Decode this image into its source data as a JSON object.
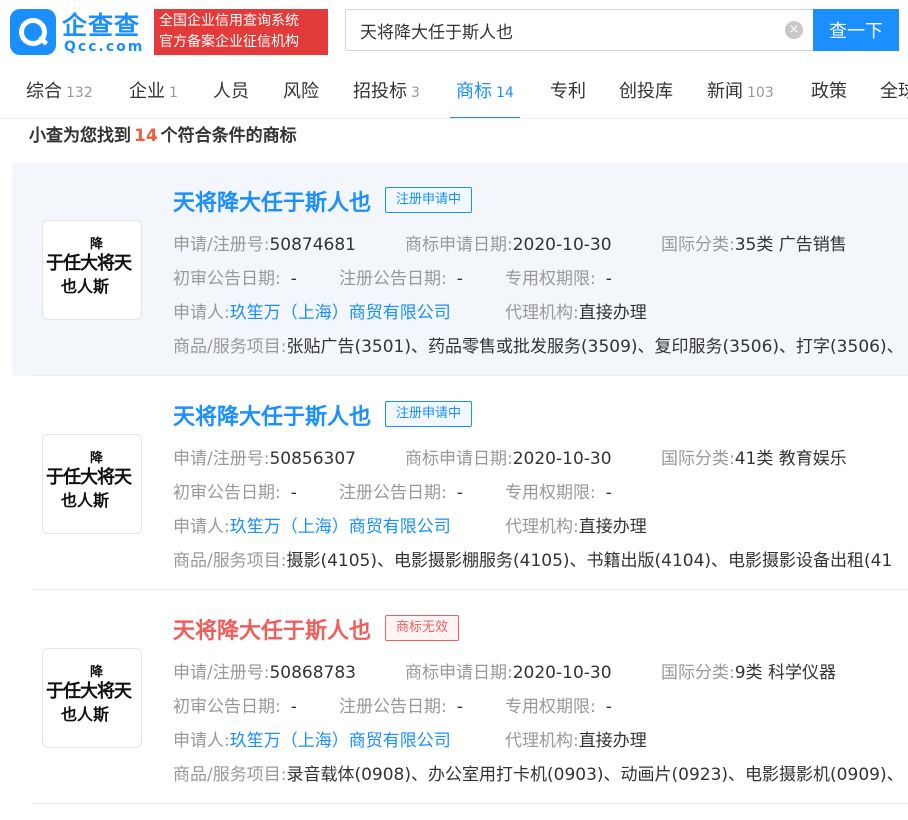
{
  "header": {
    "logo_cn": "企查查",
    "logo_en": "Qcc.com",
    "slogan_line1": "全国企业信用查询系统",
    "slogan_line2": "官方备案企业征信机构",
    "search_value": "天将降大任于斯人也",
    "clear_icon": "close-circle-icon",
    "search_button": "查一下",
    "brand_color": "#1a8ffd"
  },
  "tabs": [
    {
      "label": "综合",
      "count": "132"
    },
    {
      "label": "企业",
      "count": "1"
    },
    {
      "label": "人员",
      "count": ""
    },
    {
      "label": "风险",
      "count": ""
    },
    {
      "label": "招投标",
      "count": "3"
    },
    {
      "label": "商标",
      "count": "14",
      "active": true
    },
    {
      "label": "专利",
      "count": ""
    },
    {
      "label": "创投库",
      "count": ""
    },
    {
      "label": "新闻",
      "count": "103"
    },
    {
      "label": "政策",
      "count": ""
    },
    {
      "label": "全球",
      "count": ""
    }
  ],
  "summary": {
    "prefix": "小查为您找到",
    "count": "14",
    "suffix": "个符合条件的商标"
  },
  "labels": {
    "reg_no": "申请/注册号:",
    "apply_date": "商标申请日期:",
    "intl_class": "国际分类:",
    "prelim_date": "初审公告日期:",
    "reg_date": "注册公告日期:",
    "exclusive": "专用权期限:",
    "applicant": "申请人:",
    "agency": "代理机构:",
    "goods": "商品/服务项目:"
  },
  "logo_glyphs": {
    "top": "降",
    "line1": "于任大将天",
    "line2": "也人斯"
  },
  "results": [
    {
      "title": "天将降大任于斯人也",
      "status": "注册申请中",
      "status_color": "blue",
      "reg_no": "50874681",
      "apply_date": "2020-10-30",
      "intl_class": "35类 广告销售",
      "prelim_date": "-",
      "reg_date": "-",
      "exclusive": "-",
      "applicant": "玖笙万（上海）商贸有限公司",
      "agency": "直接办理",
      "goods": "张贴广告(3501)、药品零售或批发服务(3509)、复印服务(3506)、打字(3506)、"
    },
    {
      "title": "天将降大任于斯人也",
      "status": "注册申请中",
      "status_color": "blue",
      "reg_no": "50856307",
      "apply_date": "2020-10-30",
      "intl_class": "41类 教育娱乐",
      "prelim_date": "-",
      "reg_date": "-",
      "exclusive": "-",
      "applicant": "玖笙万（上海）商贸有限公司",
      "agency": "直接办理",
      "goods": "摄影(4105)、电影摄影棚服务(4105)、书籍出版(4104)、电影摄影设备出租(41"
    },
    {
      "title": "天将降大任于斯人也",
      "status": "商标无效",
      "status_color": "red",
      "reg_no": "50868783",
      "apply_date": "2020-10-30",
      "intl_class": "9类 科学仪器",
      "prelim_date": "-",
      "reg_date": "-",
      "exclusive": "-",
      "applicant": "玖笙万（上海）商贸有限公司",
      "agency": "直接办理",
      "goods": "录音载体(0908)、办公室用打卡机(0903)、动画片(0923)、电影摄影机(0909)、"
    }
  ]
}
